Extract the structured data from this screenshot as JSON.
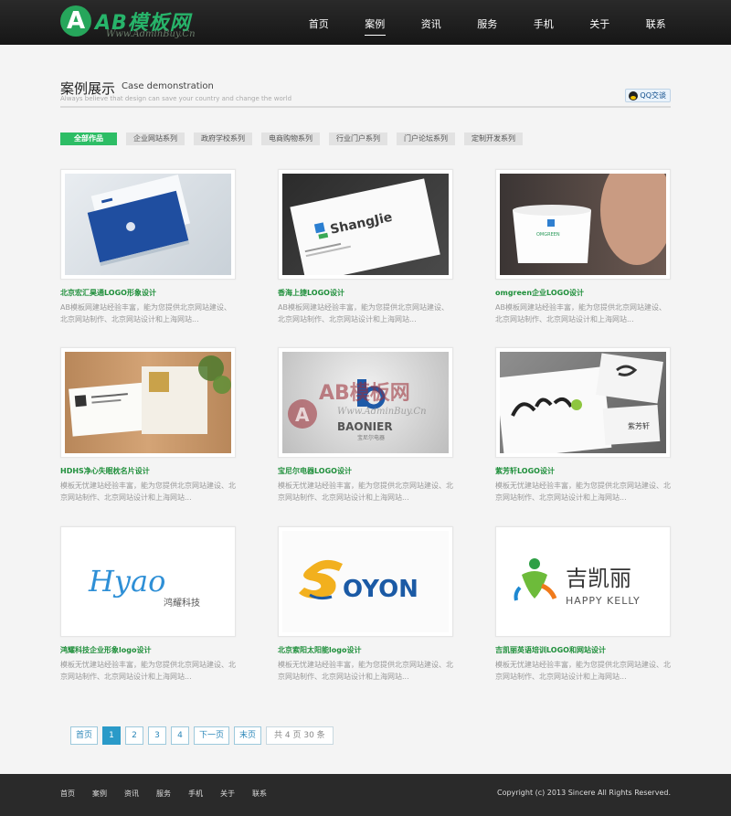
{
  "brand": {
    "badge": "A",
    "name": "AB模板网",
    "url": "Www.AdminBuy.Cn"
  },
  "nav": {
    "items": [
      "首页",
      "案例",
      "资讯",
      "服务",
      "手机",
      "关于",
      "联系"
    ],
    "active": "案例"
  },
  "section": {
    "title_cn": "案例展示",
    "title_en": "Case demonstration",
    "subtitle": "Always believe that design can save your country and change the world",
    "qq_label": "QQ交谈"
  },
  "filters": [
    "全部作品",
    "企业网站系列",
    "政府学校系列",
    "电商购物系列",
    "行业门户系列",
    "门户论坛系列",
    "定制开发系列"
  ],
  "cases": [
    {
      "title": "北京宏汇昊通LOGO形象设计",
      "desc": "AB模板网建站经验丰富，能为您提供北京网站建设、北京网站制作、北京网站设计和上海网站..."
    },
    {
      "title": "香海上捷LOGO设计",
      "desc": "AB模板网建站经验丰富，能为您提供北京网站建设、北京网站制作、北京网站设计和上海网站..."
    },
    {
      "title": "omgreen企业LOGO设计",
      "desc": "AB模板网建站经验丰富，能为您提供北京网站建设、北京网站制作、北京网站设计和上海网站..."
    },
    {
      "title": "HDHS净心失眠枕名片设计",
      "desc": "模板无忧建站经验丰富，能为您提供北京网站建设、北京网站制作、北京网站设计和上海网站..."
    },
    {
      "title": "宝尼尔电器LOGO设计",
      "desc": "模板无忧建站经验丰富，能为您提供北京网站建设、北京网站制作、北京网站设计和上海网站..."
    },
    {
      "title": "紫芳轩LOGO设计",
      "desc": "模板无忧建站经验丰富，能为您提供北京网站建设、北京网站制作、北京网站设计和上海网站..."
    },
    {
      "title": "鸿耀科技企业形象logo设计",
      "desc": "模板无忧建站经验丰富，能为您提供北京网站建设、北京网站制作、北京网站设计和上海网站..."
    },
    {
      "title": "北京索阳太阳能logo设计",
      "desc": "模板无忧建站经验丰富，能为您提供北京网站建设、北京网站制作、北京网站设计和上海网站..."
    },
    {
      "title": "吉凯丽英语培训LOGO和网站设计",
      "desc": "模板无忧建站经验丰富，能为您提供北京网站建设、北京网站制作、北京网站设计和上海网站..."
    }
  ],
  "thumb_text": {
    "shangjie": "ShangJie",
    "omgreen": "OMGREEN",
    "baonier": "BAONIER",
    "baonier_cn": "宝尼尔电器",
    "hyao": "Hyao",
    "hyao_cn": "鸿耀科技",
    "soyon": "OYON",
    "jkl_cn": "吉凯丽",
    "jkl_en": "HAPPY KELLY",
    "zfx": "紫芳轩"
  },
  "watermark": {
    "name": "AB模板网",
    "url": "Www.AdminBuy.Cn"
  },
  "pager": {
    "first": "首页",
    "pages": [
      "1",
      "2",
      "3",
      "4"
    ],
    "current": "1",
    "next": "下一页",
    "last": "末页",
    "info": "共 4 页 30 条"
  },
  "footer": {
    "links": [
      "首页",
      "案例",
      "资讯",
      "服务",
      "手机",
      "关于",
      "联系"
    ],
    "copyright": "Copyright (c) 2013 Sincere All Rights Reserved."
  },
  "colors": {
    "accent": "#2dbd65",
    "title_green": "#1f8f3b",
    "pager_blue": "#2a9ac8",
    "header_bg": "#1c1c1c"
  }
}
